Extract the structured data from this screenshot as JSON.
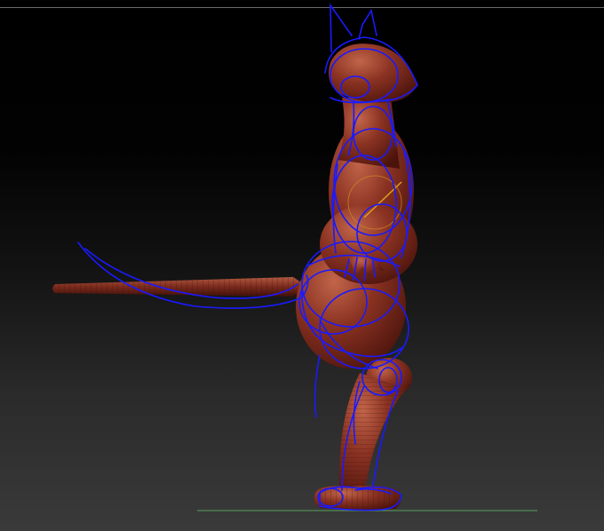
{
  "viewport": {
    "background_top": "#000000",
    "background_bottom": "#3a3a3a",
    "floor_line_color": "#5aa05a",
    "top_rule_color": "#6b6b6b"
  },
  "model": {
    "icon": "standing-rat-sculpt",
    "surface_color": "#8a3222",
    "highlight_color": "#c2654a",
    "shadow_color": "#4a130c",
    "overlay_stroke_color": "#1a1aff",
    "transpose_line_color": "#e0a020"
  }
}
